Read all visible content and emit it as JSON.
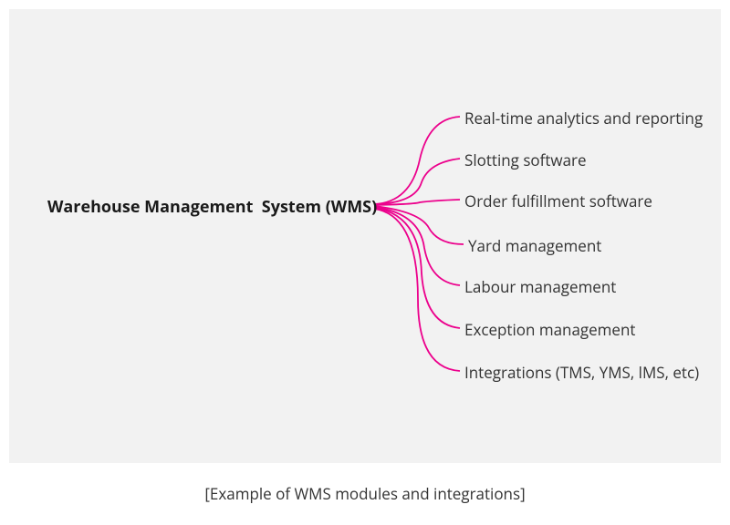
{
  "diagram": {
    "root": "Warehouse Management  System (WMS)",
    "modules": [
      "Real-time analytics and reporting",
      "Slotting software",
      "Order fulfillment software",
      "Yard management",
      "Labour management",
      "Exception management",
      "Integrations (TMS, YMS, lMS, etc)"
    ],
    "connector_color": "#ec008c"
  },
  "caption": "[Example of WMS modules and integrations]"
}
